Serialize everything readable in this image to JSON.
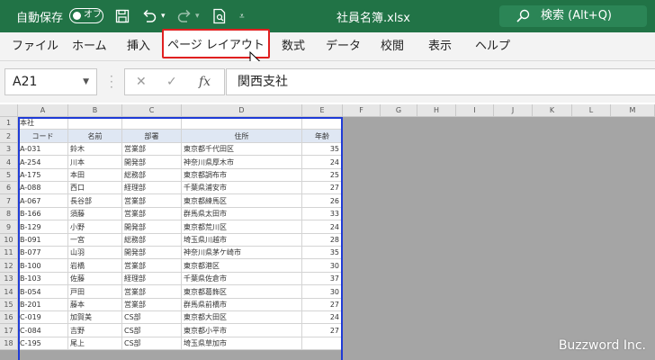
{
  "titlebar": {
    "autosave_label": "自動保存",
    "autosave_state": "オフ",
    "filename": "社員名簿.xlsx",
    "search_text": "検索 (Alt+Q)",
    "accent": "#217346"
  },
  "ribbon": {
    "tabs": [
      {
        "label": "ファイル"
      },
      {
        "label": "ホーム"
      },
      {
        "label": "挿入"
      },
      {
        "label": "ページ レイアウト"
      },
      {
        "label": "数式"
      },
      {
        "label": "データ"
      },
      {
        "label": "校閲"
      },
      {
        "label": "表示"
      },
      {
        "label": "ヘルプ"
      }
    ],
    "active_tab": "ページ レイアウト"
  },
  "formula_bar": {
    "name_box": "A21",
    "fx_label": "fx",
    "formula": "関西支社"
  },
  "sheet": {
    "columns": [
      "A",
      "B",
      "C",
      "D",
      "E",
      "F",
      "G",
      "H",
      "I",
      "J",
      "K",
      "L",
      "M"
    ],
    "title_cell": "本社",
    "headers": [
      "コード",
      "名前",
      "部署",
      "住所",
      "年齢"
    ],
    "rows": [
      [
        "A-031",
        "鈴木",
        "営業部",
        "東京都千代田区",
        "35"
      ],
      [
        "A-254",
        "川本",
        "開発部",
        "神奈川県厚木市",
        "24"
      ],
      [
        "A-175",
        "本田",
        "総務部",
        "東京都調布市",
        "25"
      ],
      [
        "A-088",
        "西口",
        "経理部",
        "千葉県浦安市",
        "27"
      ],
      [
        "A-067",
        "長谷部",
        "営業部",
        "東京都練馬区",
        "26"
      ],
      [
        "B-166",
        "須藤",
        "営業部",
        "群馬県太田市",
        "33"
      ],
      [
        "B-129",
        "小野",
        "開発部",
        "東京都荒川区",
        "24"
      ],
      [
        "B-091",
        "一宮",
        "総務部",
        "埼玉県川越市",
        "28"
      ],
      [
        "B-077",
        "山羽",
        "開発部",
        "神奈川県茅ケ崎市",
        "35"
      ],
      [
        "B-100",
        "岩橋",
        "営業部",
        "東京都港区",
        "30"
      ],
      [
        "B-103",
        "佐藤",
        "経理部",
        "千葉県佐倉市",
        "37"
      ],
      [
        "B-054",
        "戸田",
        "営業部",
        "東京都葛飾区",
        "30"
      ],
      [
        "B-201",
        "藤本",
        "営業部",
        "群馬県前橋市",
        "27"
      ],
      [
        "C-019",
        "加賀美",
        "CS部",
        "東京都大田区",
        "24"
      ],
      [
        "C-084",
        "吉野",
        "CS部",
        "東京都小平市",
        "27"
      ],
      [
        "C-195",
        "尾上",
        "CS部",
        "埼玉県草加市",
        ""
      ]
    ]
  },
  "watermark": "Buzzword Inc."
}
